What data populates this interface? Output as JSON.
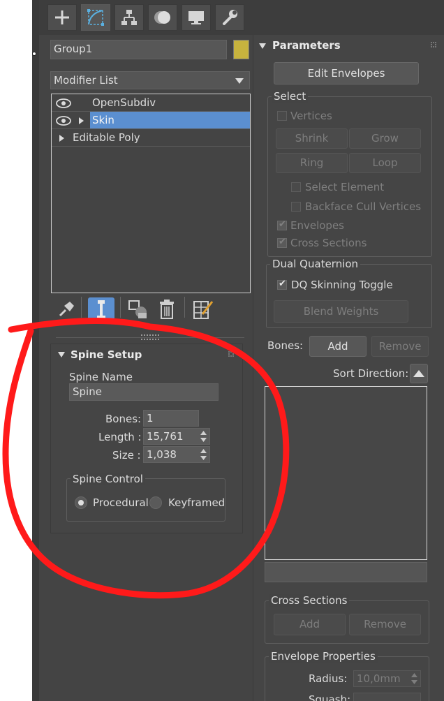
{
  "object": {
    "name": "Group1",
    "color": "#c7b33e"
  },
  "tabs": [
    "create",
    "modify",
    "hierarchy",
    "motion",
    "display",
    "utilities"
  ],
  "modifier_list": {
    "label": "Modifier List",
    "stack": [
      {
        "label": "OpenSubdiv",
        "visible": true,
        "selected": false
      },
      {
        "label": "Skin",
        "visible": true,
        "selected": true
      },
      {
        "label": "Editable Poly",
        "visible": false,
        "selected": false
      }
    ]
  },
  "stack_toolbar": [
    "pin-stack",
    "show-end-result",
    "make-unique",
    "remove-modifier",
    "configure-modifier-sets"
  ],
  "spine_setup": {
    "title": "Spine Setup",
    "spine_name_label": "Spine Name",
    "spine_name": "Spine",
    "bones_label": "Bones:",
    "bones": "1",
    "length_label": "Length :",
    "length": "15,761",
    "size_label": "Size :",
    "size": "1,038",
    "control_title": "Spine Control",
    "procedural": "Procedural",
    "keyframed": "Keyframed",
    "selected_control": "Procedural"
  },
  "parameters": {
    "title": "Parameters",
    "edit_envelopes": "Edit Envelopes",
    "select_title": "Select",
    "vertices": "Vertices",
    "shrink": "Shrink",
    "grow": "Grow",
    "ring": "Ring",
    "loop": "Loop",
    "select_element": "Select Element",
    "backface_cull": "Backface Cull Vertices",
    "envelopes": "Envelopes",
    "cross_sections": "Cross Sections",
    "dq_title": "Dual Quaternion",
    "dq_toggle": "DQ Skinning Toggle",
    "blend_weights": "Blend Weights",
    "bones_label": "Bones:",
    "add": "Add",
    "remove": "Remove",
    "sort_direction": "Sort Direction:",
    "cs_title": "Cross Sections",
    "cs_add": "Add",
    "cs_remove": "Remove",
    "env_title": "Envelope Properties",
    "radius_label": "Radius:",
    "radius": "10,0mm",
    "squash_label": "Squash:"
  },
  "annotation_color": "#ff1a1a"
}
